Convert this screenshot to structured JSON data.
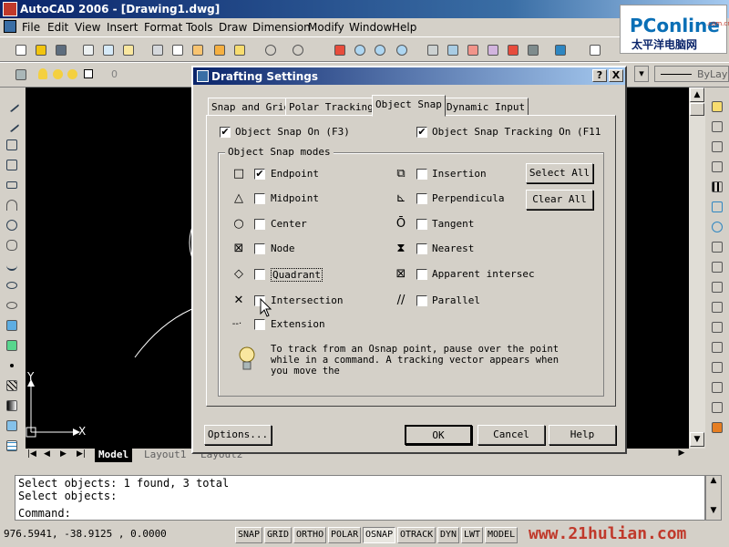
{
  "window": {
    "title": "AutoCAD 2006 - [Drawing1.dwg]"
  },
  "menu": [
    "File",
    "Edit",
    "View",
    "Insert",
    "Format",
    "Tools",
    "Draw",
    "Dimension",
    "Modify",
    "Window",
    "Help"
  ],
  "logo": {
    "brand": "PConline",
    "brand_suffix": ".com.cn",
    "tagline": "太平洋电脑网"
  },
  "layers": {
    "layer_value": "0",
    "linetype_value": "ByLay"
  },
  "dialog": {
    "title": "Drafting Settings",
    "help_btn": "?",
    "close_btn": "X",
    "tabs": [
      "Snap and Grid",
      "Polar Tracking",
      "Object Snap",
      "Dynamic Input"
    ],
    "active_tab": "Object Snap",
    "osnap_on": {
      "label": "Object Snap On (F3)",
      "checked": true
    },
    "osnap_tracking": {
      "label": "Object Snap Tracking On (F11",
      "checked": true
    },
    "modes_group": "Object Snap modes",
    "modes_left": [
      {
        "symbol": "□",
        "label": "Endpoint",
        "checked": true
      },
      {
        "symbol": "△",
        "label": "Midpoint",
        "checked": false
      },
      {
        "symbol": "○",
        "label": "Center",
        "checked": false
      },
      {
        "symbol": "⊠",
        "label": "Node",
        "checked": false
      },
      {
        "symbol": "◇",
        "label": "Quadrant",
        "checked": false
      },
      {
        "symbol": "✕",
        "label": "Intersection",
        "checked": false
      },
      {
        "symbol": "--·",
        "label": "Extension",
        "checked": false
      }
    ],
    "modes_right": [
      {
        "symbol": "⧉",
        "label": "Insertion",
        "checked": false
      },
      {
        "symbol": "⊾",
        "label": "Perpendicula",
        "checked": false
      },
      {
        "symbol": "Ō",
        "label": "Tangent",
        "checked": false
      },
      {
        "symbol": "⧗",
        "label": "Nearest",
        "checked": false
      },
      {
        "symbol": "⊠",
        "label": "Apparent intersec",
        "checked": false
      },
      {
        "symbol": "//",
        "label": "Parallel",
        "checked": false
      }
    ],
    "select_all": "Select All",
    "clear_all": "Clear All",
    "tip_text": "To track from an Osnap point, pause over the point while in a command.  A tracking vector appears when you move the",
    "options_btn": "Options...",
    "ok_btn": "OK",
    "cancel_btn": "Cancel",
    "help_button": "Help"
  },
  "layout_tabs": [
    "Model",
    "Layout1",
    "Layout2"
  ],
  "axis": {
    "x": "X",
    "y": "Y"
  },
  "command": {
    "lines": [
      "Select objects: 1 found, 3 total",
      "Select objects:",
      "Command:"
    ]
  },
  "status": {
    "coords": "976.5941,   -38.9125 , 0.0000",
    "buttons": [
      {
        "label": "SNAP",
        "on": false
      },
      {
        "label": "GRID",
        "on": false
      },
      {
        "label": "ORTHO",
        "on": false
      },
      {
        "label": "POLAR",
        "on": false
      },
      {
        "label": "OSNAP",
        "on": true
      },
      {
        "label": "OTRACK",
        "on": false
      },
      {
        "label": "DYN",
        "on": false
      },
      {
        "label": "LWT",
        "on": false
      },
      {
        "label": "MODEL",
        "on": false
      }
    ],
    "watermark": "www.21hulian.com"
  }
}
